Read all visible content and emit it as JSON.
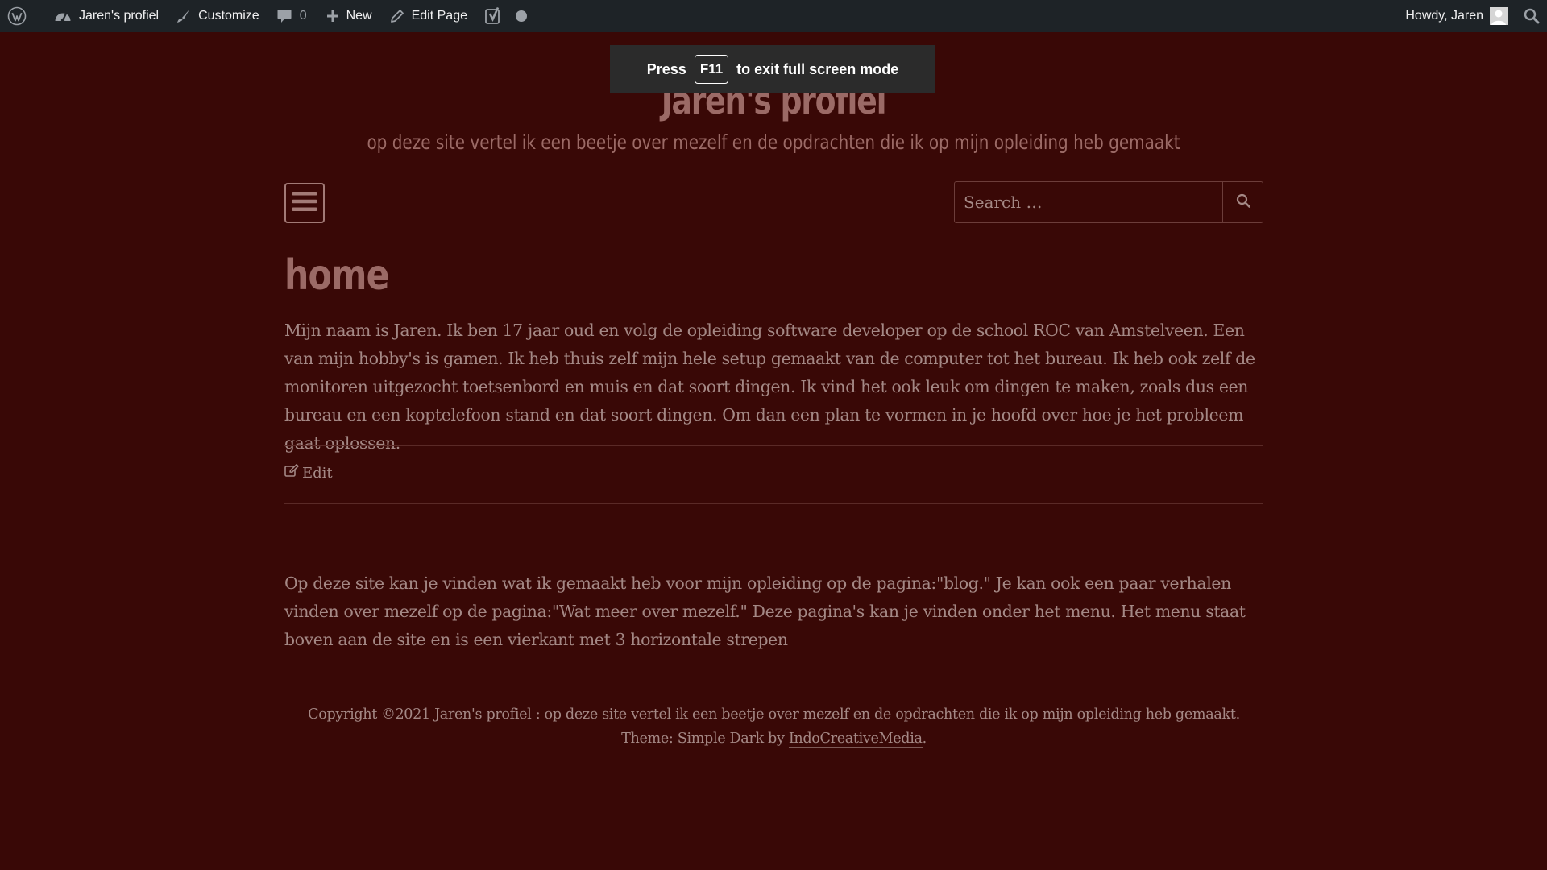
{
  "adminbar": {
    "site_name": "Jaren's profiel",
    "customize": "Customize",
    "comments_count": "0",
    "new": "New",
    "edit_page": "Edit Page",
    "howdy": "Howdy, Jaren"
  },
  "fullscreen_toast": {
    "press": "Press",
    "key": "F11",
    "message": "to exit full screen mode"
  },
  "site": {
    "title": "Jaren's profiel",
    "description": "op deze site vertel ik een beetje over mezelf en de opdrachten die ik op mijn opleiding heb gemaakt"
  },
  "search": {
    "placeholder": "Search …"
  },
  "page": {
    "title": "home",
    "paragraph_1": "Mijn naam is Jaren. Ik ben 17 jaar oud en volg de opleiding software developer op de school ROC van Amstelveen. Een van mijn hobby's is gamen. Ik heb thuis zelf mijn hele setup gemaakt van de computer tot het bureau. Ik heb ook zelf de monitoren uitgezocht toetsenbord en muis en dat soort dingen. Ik vind het ook leuk om dingen te maken, zoals dus een bureau en een koptelefoon stand en dat soort dingen. Om dan een plan te vormen in je hoofd over hoe je het probleem gaat oplossen.",
    "edit_label": "Edit",
    "paragraph_2": "Op deze site kan je vinden wat ik gemaakt heb voor mijn opleiding op de pagina:\"blog.\" Je kan ook een paar verhalen vinden over mezelf op de pagina:\"Wat meer over mezelf.\" Deze pagina's kan je vinden onder het menu. Het menu staat boven aan de site en is een vierkant met 3 horizontale strepen"
  },
  "footer": {
    "copyright": "Copyright ©2021",
    "site_link": "Jaren's profiel",
    "separator": " : ",
    "desc_link": "op deze site vertel ik een beetje over mezelf en de opdrachten die ik op mijn opleiding heb gemaakt",
    "theme_text": ". Theme: Simple Dark by ",
    "theme_link": "IndoCreativeMedia",
    "end": "."
  },
  "colors": {
    "background": "#390806",
    "adminbar": "#1e2327",
    "text": "#a48885",
    "title": "#9b6a66"
  }
}
